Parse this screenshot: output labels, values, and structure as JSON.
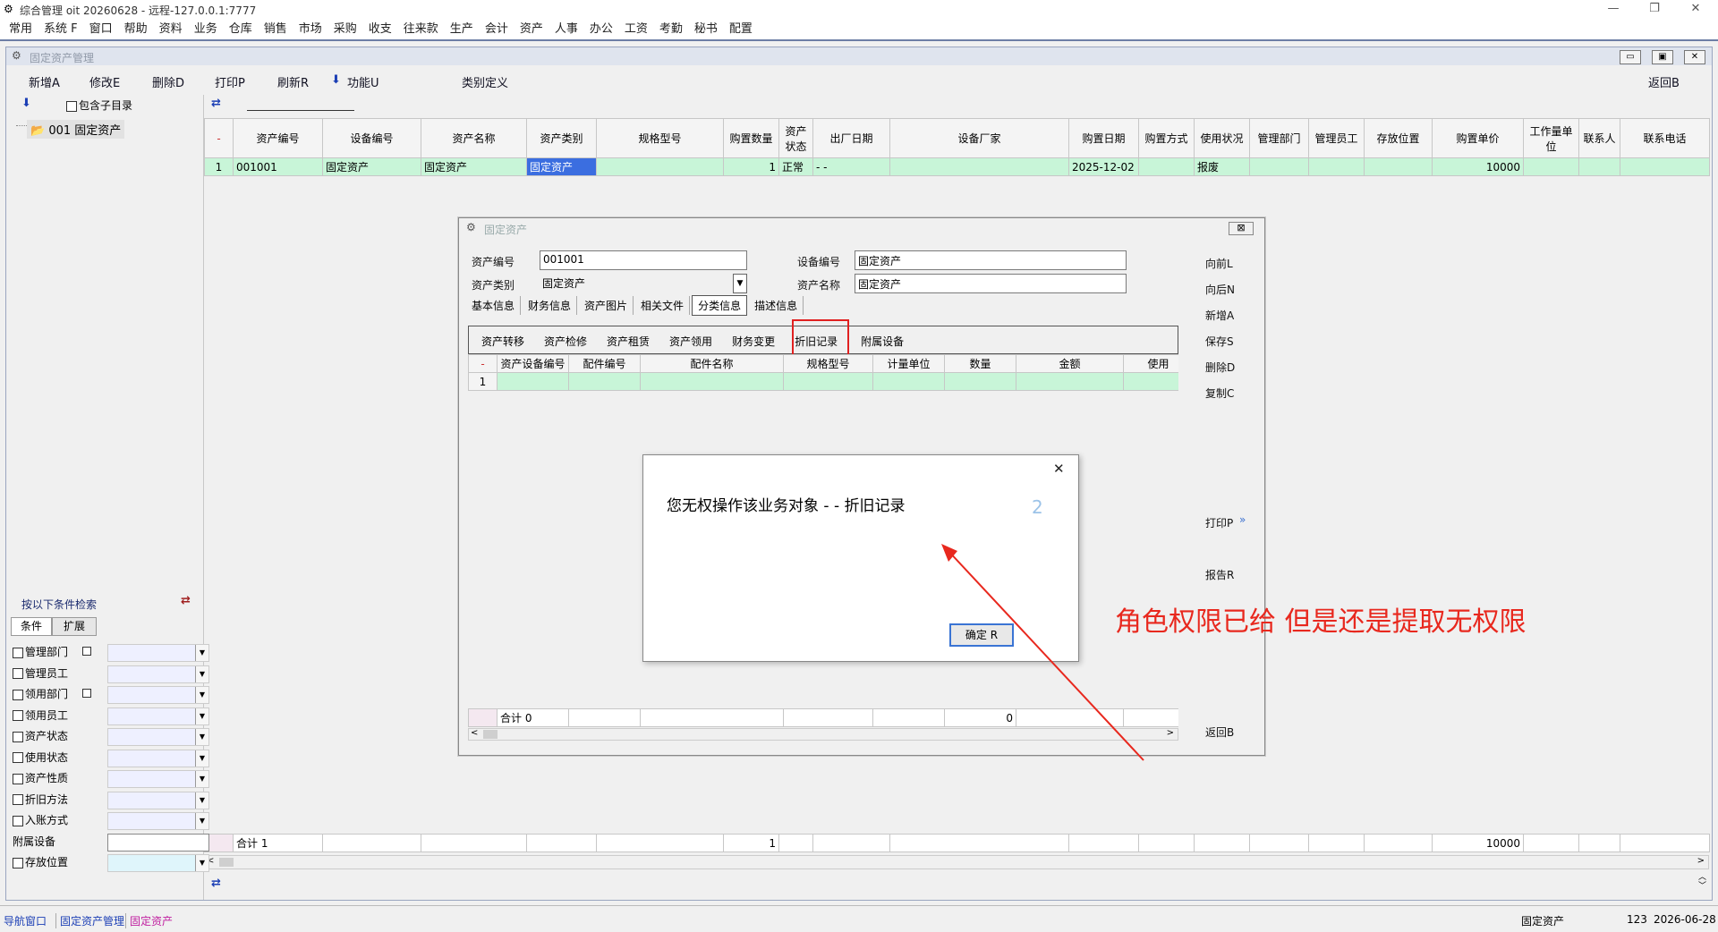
{
  "window": {
    "title": "综合管理 oit 20260628 - 远程-127.0.0.1:7777",
    "minimize": "—",
    "restore": "❐",
    "close": "✕"
  },
  "menu": [
    "常用",
    "系统 F",
    "窗口",
    "帮助",
    "资料",
    "业务",
    "仓库",
    "销售",
    "市场",
    "采购",
    "收支",
    "往来款",
    "生产",
    "会计",
    "资产",
    "人事",
    "办公",
    "工资",
    "考勤",
    "秘书",
    "配置"
  ],
  "child": {
    "title": "固定资产管理",
    "ctl_min": "▭",
    "ctl_max": "▣",
    "ctl_close": "✕"
  },
  "toolbar": {
    "add": "新增A",
    "edit": "修改E",
    "delete": "删除D",
    "print": "打印P",
    "refresh": "刷新R",
    "function": "功能U",
    "category": "类别定义",
    "return": "返回B"
  },
  "tree": {
    "include_sub": "包含子目录",
    "item": "001 固定资产"
  },
  "grid": {
    "headers": [
      "-",
      "资产编号",
      "设备编号",
      "资产名称",
      "资产类别",
      "规格型号",
      "购置数量",
      "资产状态",
      "出厂日期",
      "设备厂家",
      "购置日期",
      "购置方式",
      "使用状况",
      "管理部门",
      "管理员工",
      "存放位置",
      "购置单价",
      "工作量单位",
      "联系人",
      "联系电话"
    ],
    "rows": [
      [
        "1",
        "001001",
        "固定资产",
        "固定资产",
        "固定资产",
        "",
        "1",
        "正常",
        "- -",
        "",
        "2025-12-02",
        "",
        "报废",
        "",
        "",
        "",
        "10000",
        "",
        "",
        ""
      ]
    ],
    "footer": [
      "",
      "合计 1",
      "",
      "",
      "",
      "",
      "1",
      "",
      "",
      "",
      "",
      "",
      "",
      "",
      "",
      "",
      "10000",
      "",
      "",
      ""
    ]
  },
  "search": {
    "title": "按以下条件检索",
    "tab_cond": "条件",
    "tab_ext": "扩展",
    "conditions": [
      "管理部门",
      "管理员工",
      "领用部门",
      "领用员工",
      "资产状态",
      "使用状态",
      "资产性质",
      "折旧方法",
      "入账方式",
      "附属设备",
      "存放位置"
    ]
  },
  "dialog": {
    "title": "固定资产",
    "close": "⊠",
    "labels": {
      "asset_no": "资产编号",
      "asset_cat": "资产类别",
      "device_no": "设备编号",
      "asset_name": "资产名称"
    },
    "values": {
      "asset_no": "001001",
      "asset_cat": "固定资产",
      "device_no": "固定资产",
      "asset_name": "固定资产"
    },
    "tabs": [
      "基本信息",
      "财务信息",
      "资产图片",
      "相关文件",
      "分类信息",
      "描述信息"
    ],
    "subtabs": [
      "资产转移",
      "资产检修",
      "资产租赁",
      "资产领用",
      "财务变更",
      "折旧记录",
      "附属设备"
    ],
    "sub_headers": [
      "-",
      "资产设备编号",
      "配件编号",
      "配件名称",
      "规格型号",
      "计量单位",
      "数量",
      "金额",
      "使用"
    ],
    "sub_row": [
      "1",
      "",
      "",
      "",
      "",
      "",
      "",
      "",
      ""
    ],
    "sub_footer": [
      "",
      "合计 0",
      "",
      "",
      "",
      "",
      "0",
      "",
      ""
    ],
    "side_buttons": {
      "prev": "向前L",
      "next": "向后N",
      "add": "新增A",
      "save": "保存S",
      "delete": "删除D",
      "copy": "复制C",
      "print": "打印P",
      "report": "报告R",
      "return": "返回B"
    }
  },
  "message": {
    "text": "您无权操作该业务对象 - - 折旧记录",
    "badge": "2",
    "ok": "确定 R",
    "close": "✕"
  },
  "annotation": {
    "text": "角色权限已给 但是还是提取无权限",
    "color": "#e8281e"
  },
  "status": {
    "nav": "导航窗口",
    "tab1": "固定资产管理",
    "tab2": "固定资产",
    "right": "固定资产",
    "code": "123",
    "date": "2026-06-28"
  }
}
